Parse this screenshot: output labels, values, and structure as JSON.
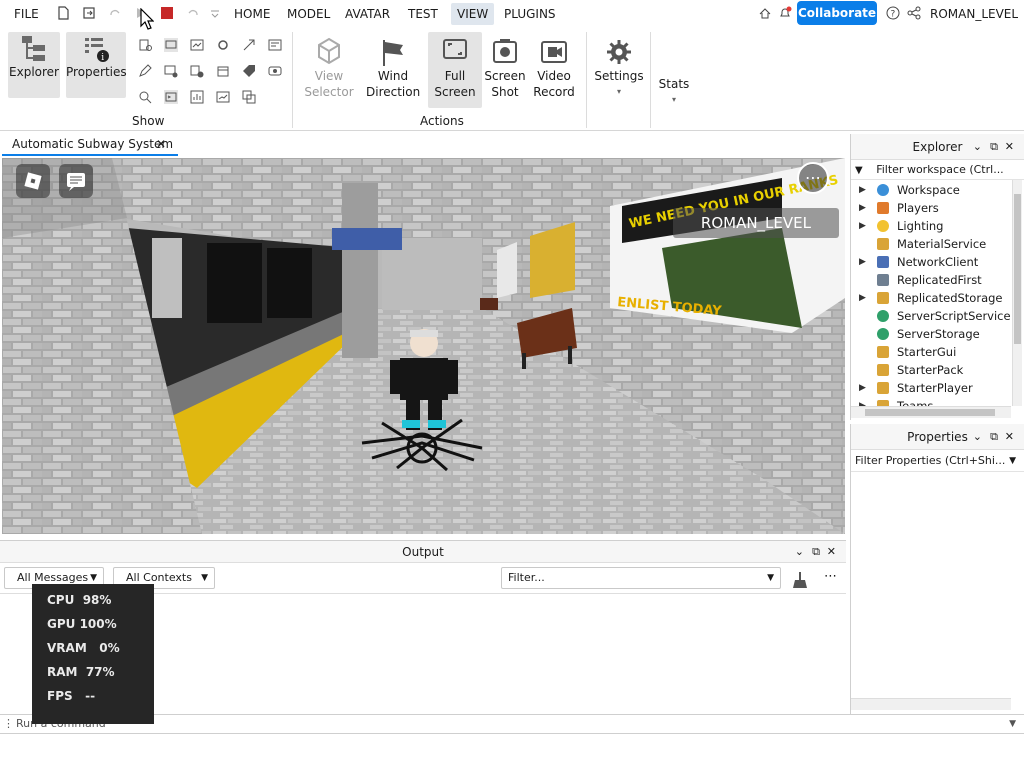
{
  "menu": {
    "file": "FILE",
    "tabs": [
      "HOME",
      "MODEL",
      "AVATAR",
      "TEST",
      "VIEW",
      "PLUGINS"
    ],
    "active_tab": "VIEW",
    "collaborate": "Collaborate",
    "username": "ROMAN_LEVEL"
  },
  "ribbon": {
    "show_group": {
      "label": "Show",
      "explorer": "Explorer",
      "properties": "Properties"
    },
    "actions_group": {
      "label": "Actions",
      "view_selector_1": "View",
      "view_selector_2": "Selector",
      "wind_direction_1": "Wind",
      "wind_direction_2": "Direction",
      "full_screen_1": "Full",
      "full_screen_2": "Screen",
      "screen_shot_1": "Screen",
      "screen_shot_2": "Shot",
      "video_record_1": "Video",
      "video_record_2": "Record"
    },
    "settings": "Settings",
    "stats": "Stats"
  },
  "document_tab": "Automatic Subway System",
  "viewport": {
    "overlay_username": "ROMAN_LEVEL",
    "poster_text_top": "WE NEED YOU IN OUR RANKS",
    "poster_text_bottom": "ENLIST TODAY"
  },
  "output": {
    "title": "Output",
    "messages_filter": "All Messages",
    "contexts_filter": "All Contexts",
    "search_placeholder": "Filter..."
  },
  "performance": {
    "cpu": "CPU  98%",
    "gpu": "GPU 100%",
    "vram": "VRAM   0%",
    "ram": "RAM  77%",
    "fps": "FPS   --"
  },
  "command_bar": "Run a command",
  "explorer": {
    "title": "Explorer",
    "filter": "Filter workspace (Ctrl...",
    "items": [
      {
        "label": "Workspace",
        "expandable": true,
        "color": "#3a8fd8"
      },
      {
        "label": "Players",
        "expandable": true,
        "color": "#e07a2c"
      },
      {
        "label": "Lighting",
        "expandable": true,
        "color": "#f2c230"
      },
      {
        "label": "MaterialService",
        "expandable": false,
        "color": "#d9a437"
      },
      {
        "label": "NetworkClient",
        "expandable": true,
        "color": "#4a6fb5"
      },
      {
        "label": "ReplicatedFirst",
        "expandable": false,
        "color": "#6f7f91"
      },
      {
        "label": "ReplicatedStorage",
        "expandable": true,
        "color": "#d9a437"
      },
      {
        "label": "ServerScriptService",
        "expandable": false,
        "color": "#2fa06a"
      },
      {
        "label": "ServerStorage",
        "expandable": false,
        "color": "#2fa06a"
      },
      {
        "label": "StarterGui",
        "expandable": false,
        "color": "#d9a437"
      },
      {
        "label": "StarterPack",
        "expandable": false,
        "color": "#d9a437"
      },
      {
        "label": "StarterPlayer",
        "expandable": true,
        "color": "#d9a437"
      },
      {
        "label": "Teams",
        "expandable": true,
        "color": "#d9a437"
      }
    ]
  },
  "properties_panel": {
    "title": "Properties",
    "filter": "Filter Properties (Ctrl+Shi..."
  }
}
